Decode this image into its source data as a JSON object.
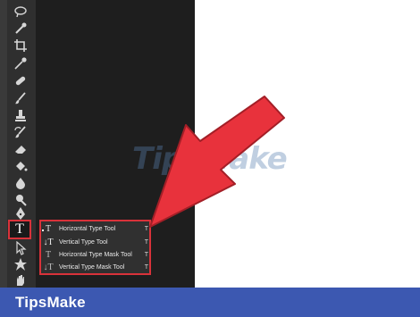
{
  "watermark": {
    "text": "TipsMake"
  },
  "footer": {
    "brand": "TipsMake",
    "color": "#3c58b1"
  },
  "toolbar": {
    "active_tool": "type-tool",
    "type_tool_glyph": "T",
    "tools": [
      "lasso-icon",
      "quick-selection-icon",
      "crop-icon",
      "eyedropper-icon",
      "spot-healing-icon",
      "brush-icon",
      "clone-stamp-icon",
      "history-brush-icon",
      "eraser-icon",
      "paint-bucket-icon",
      "blur-icon",
      "dodge-icon",
      "pen-icon",
      "type-tool-icon",
      "path-selection-icon",
      "shape-icon",
      "hand-icon"
    ]
  },
  "type_flyout": {
    "highlight_color": "#d9323a",
    "items": [
      {
        "glyph": "T",
        "label": "Horizontal Type Tool",
        "shortcut": "T",
        "active": true
      },
      {
        "glyph": "↓T",
        "label": "Vertical Type Tool",
        "shortcut": "T",
        "active": false
      },
      {
        "glyph": "T",
        "label": "Horizontal Type Mask Tool",
        "shortcut": "T",
        "active": false
      },
      {
        "glyph": "↓T",
        "label": "Vertical Type Mask Tool",
        "shortcut": "T",
        "active": false
      }
    ]
  },
  "arrow": {
    "color": "#e8323c"
  }
}
